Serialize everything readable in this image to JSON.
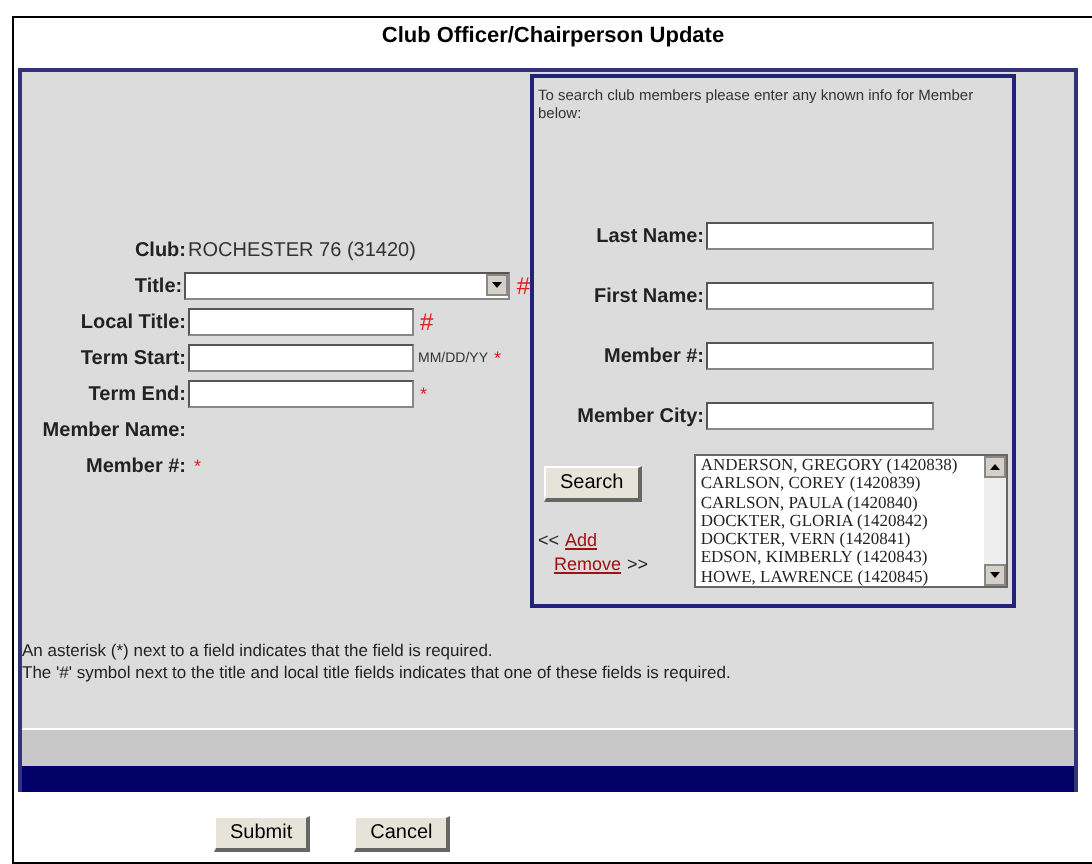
{
  "title": "Club Officer/Chairperson Update",
  "club": {
    "label": "Club:",
    "value": "ROCHESTER 76 (31420)"
  },
  "fields": [
    {
      "kind": "select",
      "label": "Title:",
      "marker": "#"
    },
    {
      "kind": "text",
      "label": "Local Title:",
      "marker": "#"
    },
    {
      "kind": "text",
      "label": "Term Start:",
      "hint": "MM/DD/YY",
      "marker": "*"
    },
    {
      "kind": "text",
      "label": "Term End:",
      "marker": "*"
    },
    {
      "kind": "plain",
      "label": "Member Name:"
    },
    {
      "kind": "plain",
      "label": "Member #:",
      "marker": "*"
    }
  ],
  "search": {
    "intro": "To search club members please enter any known info for Member below:",
    "fields": [
      {
        "label": "Last Name:"
      },
      {
        "label": "First Name:"
      },
      {
        "label": "Member #:"
      },
      {
        "label": "Member City:"
      }
    ],
    "button": "Search",
    "add": {
      "prefix": "<<",
      "link": "Add"
    },
    "remove": {
      "link": "Remove",
      "suffix": ">>"
    },
    "results": [
      {
        "text": "ANDERSON, GREGORY (1420838)",
        "selected": false
      },
      {
        "text": "CARLSON, COREY (1420839)",
        "selected": false
      },
      {
        "text": "CARLSON, PAULA (1420840)",
        "selected": false
      },
      {
        "text": "DOCKTER, GLORIA (1420842)",
        "selected": false
      },
      {
        "text": "DOCKTER, VERN (1420841)",
        "selected": false
      },
      {
        "text": "EDSON, KIMBERLY (1420843)",
        "selected": false
      },
      {
        "text": "HOWE, LAWRENCE (1420845)",
        "selected": false
      }
    ]
  },
  "notes": [
    "An asterisk (*) next to a field indicates that the field is required.",
    "The '#' symbol next to the title and local title fields indicates that one of these fields is required."
  ],
  "buttons": [
    "Submit",
    "Cancel"
  ]
}
